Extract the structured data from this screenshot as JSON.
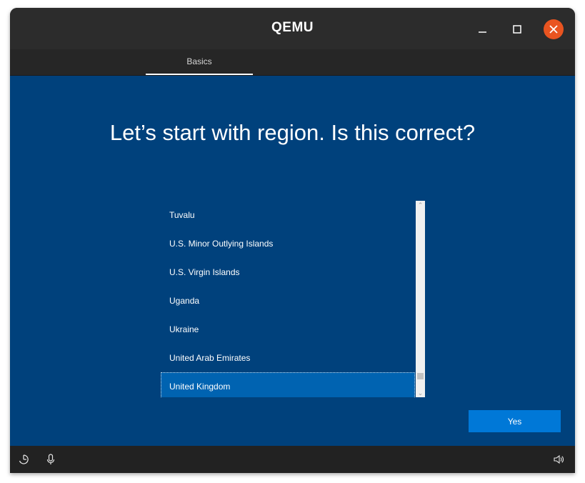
{
  "window": {
    "title": "QEMU",
    "controls": [
      "minimize-icon",
      "maximize-icon",
      "close-icon"
    ],
    "close_color": "#e95420"
  },
  "tabs": [
    {
      "label": "Basics",
      "active": true
    }
  ],
  "main": {
    "heading": "Let’s start with region. Is this correct?",
    "background_color": "#00417c",
    "region_list": {
      "items": [
        "Tuvalu",
        "U.S. Minor Outlying Islands",
        "U.S. Virgin Islands",
        "Uganda",
        "Ukraine",
        "United Arab Emirates",
        "United Kingdom"
      ],
      "selected": "United Kingdom",
      "selected_color": "#0063b1"
    },
    "confirm_button": {
      "label": "Yes",
      "color": "#0078d7"
    }
  },
  "bottom_bar": {
    "icons": [
      "accessibility-icon",
      "microphone-icon",
      "volume-icon"
    ]
  }
}
